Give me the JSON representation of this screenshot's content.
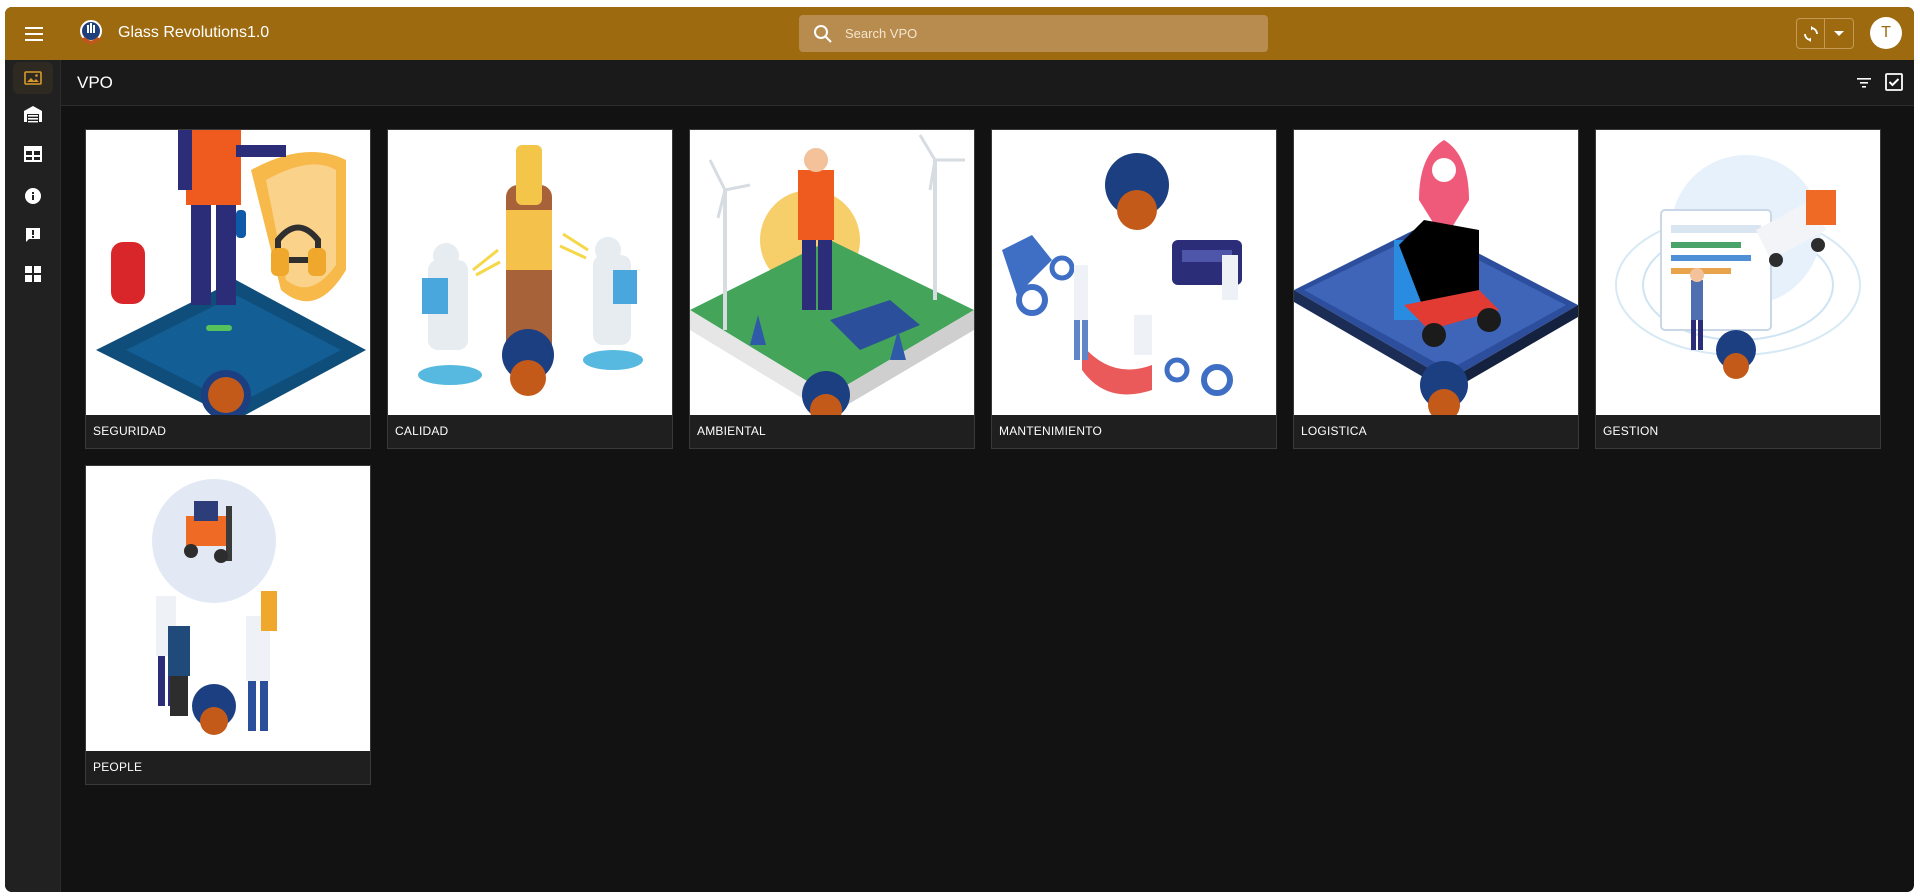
{
  "app": {
    "title": "Glass Revolutions1.0",
    "accent": "#9e6a10",
    "avatar_initial": "T"
  },
  "search": {
    "placeholder": "Search VPO"
  },
  "page": {
    "title": "VPO"
  },
  "sidebar": {
    "items": [
      {
        "icon": "image-icon",
        "active": true
      },
      {
        "icon": "warehouse-icon",
        "active": false
      },
      {
        "icon": "table-icon",
        "active": false
      },
      {
        "icon": "info-icon",
        "active": false
      },
      {
        "icon": "feedback-icon",
        "active": false
      },
      {
        "icon": "dashboard-icon",
        "active": false
      }
    ]
  },
  "cards": [
    {
      "label": "SEGURIDAD"
    },
    {
      "label": "CALIDAD"
    },
    {
      "label": "AMBIENTAL"
    },
    {
      "label": "MANTENIMIENTO"
    },
    {
      "label": "LOGISTICA"
    },
    {
      "label": "GESTION"
    },
    {
      "label": "PEOPLE"
    }
  ]
}
